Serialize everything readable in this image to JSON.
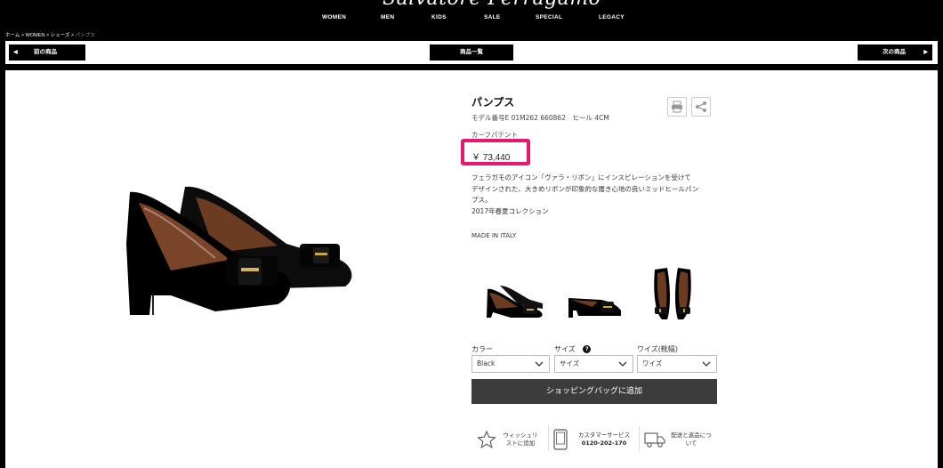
{
  "brand": {
    "logo": "Salvatore Ferragamo"
  },
  "nav": {
    "items": [
      "WOMEN",
      "MEN",
      "KIDS",
      "SALE",
      "SPECIAL",
      "LEGACY"
    ]
  },
  "breadcrumb": {
    "items": [
      "ホーム",
      "WOMEN",
      "シューズ"
    ],
    "separator": ">",
    "current": "パンプス"
  },
  "pager": {
    "prev": "前の商品",
    "list": "商品一覧",
    "next": "次の商品"
  },
  "product": {
    "title": "パンプス",
    "model": "モデル番号E 01M262 660862　ヒール 4CM",
    "material": "カーフパテント",
    "price": "￥ 73,440",
    "description": [
      "フェラガモのアイコン「ヴァラ・リボン」にインスピレーションを受けて",
      "デザインされた、大きめリボンが印象的な履き心地の良いミッドヒールパン",
      "プス。",
      "2017年春夏コレクション"
    ],
    "origin": "MADE IN ITALY"
  },
  "options": {
    "color": {
      "label": "カラー",
      "value": "Black"
    },
    "size": {
      "label": "サイズ",
      "value": "サイズ",
      "help": "?"
    },
    "width": {
      "label": "ワイズ(靴幅)",
      "value": "ワイズ"
    }
  },
  "add_to_bag": "ショッピングバッグに追加",
  "utilities": {
    "wishlist": [
      "ウィッシュリ",
      "ストに追加"
    ],
    "customer_service": {
      "label": "カスタマーサービス",
      "phone": "0120-202-170"
    },
    "shipping": [
      "配送と返品につ",
      "いて"
    ]
  },
  "colors": {
    "accent": "#e8186f",
    "header_bg": "#000000",
    "button": "#3c3c3c"
  }
}
